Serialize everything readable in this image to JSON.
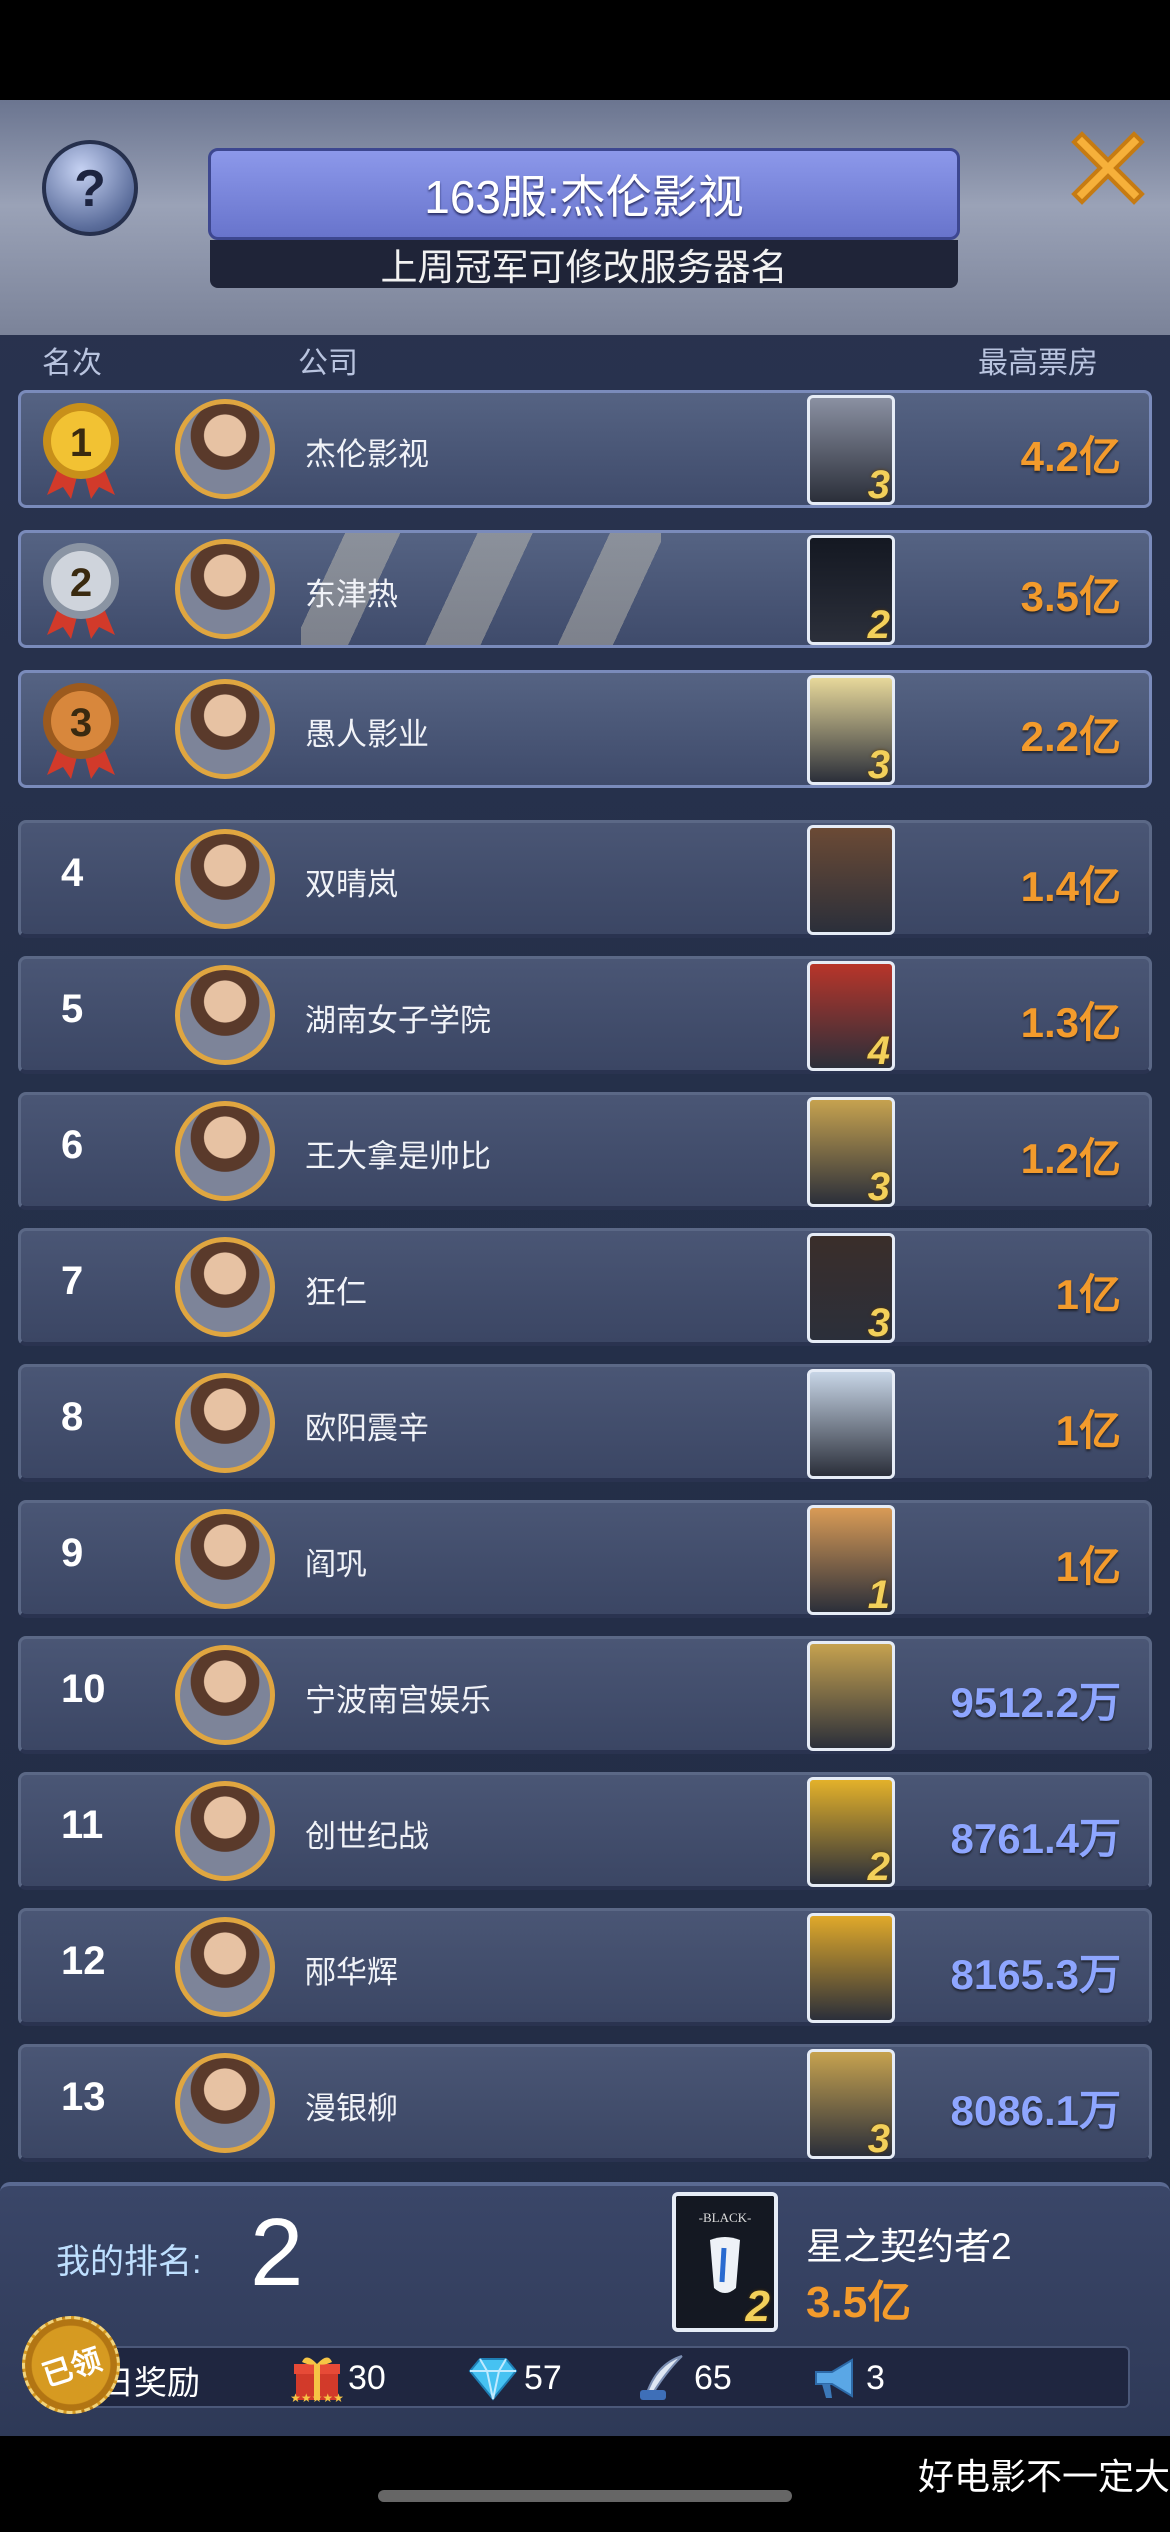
{
  "header": {
    "title": "163服:杰伦影视",
    "subtitle": "上周冠军可修改服务器名"
  },
  "columns": {
    "rank": "名次",
    "company": "公司",
    "box_office": "最高票房"
  },
  "rows": [
    {
      "rank": "1",
      "company": "杰伦影视",
      "movie_num": "3",
      "box": "4.2亿",
      "unit": "yi"
    },
    {
      "rank": "2",
      "company": "东津热",
      "movie_num": "2",
      "box": "3.5亿",
      "unit": "yi"
    },
    {
      "rank": "3",
      "company": "愚人影业",
      "movie_num": "3",
      "box": "2.2亿",
      "unit": "yi"
    },
    {
      "rank": "4",
      "company": "双晴岚",
      "movie_num": "",
      "box": "1.4亿",
      "unit": "yi"
    },
    {
      "rank": "5",
      "company": "湖南女子学院",
      "movie_num": "4",
      "box": "1.3亿",
      "unit": "yi"
    },
    {
      "rank": "6",
      "company": "王大拿是帅比",
      "movie_num": "3",
      "box": "1.2亿",
      "unit": "yi"
    },
    {
      "rank": "7",
      "company": "狂仁",
      "movie_num": "3",
      "box": "1亿",
      "unit": "yi"
    },
    {
      "rank": "8",
      "company": "欧阳震辛",
      "movie_num": "",
      "box": "1亿",
      "unit": "yi"
    },
    {
      "rank": "9",
      "company": "阎巩",
      "movie_num": "1",
      "box": "1亿",
      "unit": "yi"
    },
    {
      "rank": "10",
      "company": "宁波南宫娱乐",
      "movie_num": "",
      "box": "9512.2万",
      "unit": "wan"
    },
    {
      "rank": "11",
      "company": "创世纪战",
      "movie_num": "2",
      "box": "8761.4万",
      "unit": "wan"
    },
    {
      "rank": "12",
      "company": "邴华辉",
      "movie_num": "",
      "box": "8165.3万",
      "unit": "wan"
    },
    {
      "rank": "13",
      "company": "漫银柳",
      "movie_num": "3",
      "box": "8086.1万",
      "unit": "wan"
    }
  ],
  "my": {
    "label": "我的排名:",
    "rank": "2",
    "movie_name": "星之契约者2",
    "movie_num": "2",
    "box": "3.5亿"
  },
  "reward": {
    "label": "昨日奖励",
    "stamp": "已领",
    "items": [
      {
        "icon": "gift-icon",
        "count": "30"
      },
      {
        "icon": "diamond-icon",
        "count": "57"
      },
      {
        "icon": "quill-icon",
        "count": "65"
      },
      {
        "icon": "megaphone-icon",
        "count": "3"
      }
    ]
  },
  "ticker": "好电影不一定大",
  "colors": {
    "yi": "#f39b2c",
    "wan": "#8ea6ff",
    "title_bar": "#7a86dc"
  }
}
